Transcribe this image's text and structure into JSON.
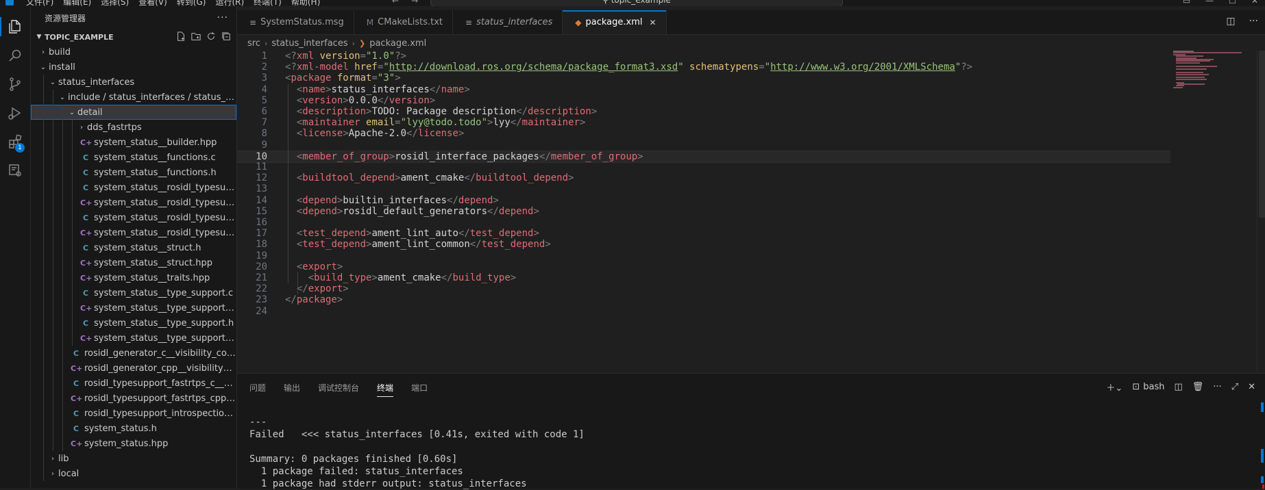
{
  "titlebar": {
    "menu": [
      "文件(F)",
      "编辑(E)",
      "选择(S)",
      "查看(V)",
      "转到(G)",
      "运行(R)",
      "终端(T)",
      "帮助(H)"
    ],
    "search_text": "topic_example"
  },
  "activity": {
    "extensions_badge": "1"
  },
  "sidebar": {
    "title": "资源管理器",
    "more": "···",
    "section": "TOPIC_EXAMPLE",
    "tree": [
      {
        "label": "build",
        "depth": 0,
        "type": "folder",
        "open": false
      },
      {
        "label": "install",
        "depth": 0,
        "type": "folder",
        "open": true
      },
      {
        "label": "status_interfaces",
        "depth": 1,
        "type": "folder",
        "open": true
      },
      {
        "label": "include / status_interfaces / status_inte…",
        "depth": 2,
        "type": "folder",
        "open": true
      },
      {
        "label": "detail",
        "depth": 3,
        "type": "folder",
        "open": true,
        "selected": true
      },
      {
        "label": "dds_fastrtps",
        "depth": 4,
        "type": "folder",
        "open": false
      },
      {
        "label": "system_status__builder.hpp",
        "depth": 4,
        "type": "cpp"
      },
      {
        "label": "system_status__functions.c",
        "depth": 4,
        "type": "c"
      },
      {
        "label": "system_status__functions.h",
        "depth": 4,
        "type": "c"
      },
      {
        "label": "system_status__rosidl_typesupport…",
        "depth": 4,
        "type": "c"
      },
      {
        "label": "system_status__rosidl_typesupport…",
        "depth": 4,
        "type": "cpp"
      },
      {
        "label": "system_status__rosidl_typesupport…",
        "depth": 4,
        "type": "c"
      },
      {
        "label": "system_status__rosidl_typesupport…",
        "depth": 4,
        "type": "cpp"
      },
      {
        "label": "system_status__struct.h",
        "depth": 4,
        "type": "c"
      },
      {
        "label": "system_status__struct.hpp",
        "depth": 4,
        "type": "cpp"
      },
      {
        "label": "system_status__traits.hpp",
        "depth": 4,
        "type": "cpp"
      },
      {
        "label": "system_status__type_support.c",
        "depth": 4,
        "type": "c"
      },
      {
        "label": "system_status__type_support.cpp",
        "depth": 4,
        "type": "cpp"
      },
      {
        "label": "system_status__type_support.h",
        "depth": 4,
        "type": "c"
      },
      {
        "label": "system_status__type_support.hpp",
        "depth": 4,
        "type": "cpp"
      },
      {
        "label": "rosidl_generator_c__visibility_control.h",
        "depth": 3,
        "type": "c"
      },
      {
        "label": "rosidl_generator_cpp__visibility_con…",
        "depth": 3,
        "type": "cpp"
      },
      {
        "label": "rosidl_typesupport_fastrtps_c__visib…",
        "depth": 3,
        "type": "c"
      },
      {
        "label": "rosidl_typesupport_fastrtps_cpp__vi…",
        "depth": 3,
        "type": "cpp"
      },
      {
        "label": "rosidl_typesupport_introspection_c_…",
        "depth": 3,
        "type": "c"
      },
      {
        "label": "system_status.h",
        "depth": 3,
        "type": "c"
      },
      {
        "label": "system_status.hpp",
        "depth": 3,
        "type": "cpp"
      },
      {
        "label": "lib",
        "depth": 1,
        "type": "folder",
        "open": false
      },
      {
        "label": "local",
        "depth": 1,
        "type": "folder",
        "open": false
      }
    ]
  },
  "tabs": [
    {
      "label": "SystemStatus.msg",
      "icon": "≡",
      "active": false,
      "italic": false
    },
    {
      "label": "CMakeLists.txt",
      "icon": "M",
      "active": false,
      "italic": false
    },
    {
      "label": "status_interfaces",
      "icon": "≡",
      "active": false,
      "italic": true
    },
    {
      "label": "package.xml",
      "icon": "◆",
      "active": true,
      "italic": false
    }
  ],
  "breadcrumb": [
    "src",
    "status_interfaces",
    "package.xml"
  ],
  "editor": {
    "current_line": 10,
    "lines": [
      {
        "n": "1",
        "tokens": [
          [
            "br",
            "<?"
          ],
          [
            "tagname",
            "xml"
          ],
          [
            "attr",
            " version"
          ],
          [
            "br",
            "="
          ],
          [
            "str",
            "\"1.0\""
          ],
          [
            "br",
            "?>"
          ]
        ]
      },
      {
        "n": "2",
        "tokens": [
          [
            "br",
            "<?"
          ],
          [
            "tagname",
            "xml-model"
          ],
          [
            "attr",
            " href"
          ],
          [
            "br",
            "="
          ],
          [
            "str",
            "\""
          ],
          [
            "url",
            "http://download.ros.org/schema/package_format3.xsd"
          ],
          [
            "str",
            "\""
          ],
          [
            "attr",
            " schematypens"
          ],
          [
            "br",
            "="
          ],
          [
            "str",
            "\""
          ],
          [
            "url",
            "http://www.w3.org/2001/XMLSchema"
          ],
          [
            "str",
            "\""
          ],
          [
            "br",
            "?>"
          ]
        ]
      },
      {
        "n": "3",
        "tokens": [
          [
            "br",
            "<"
          ],
          [
            "tagname",
            "package"
          ],
          [
            "attr",
            " format"
          ],
          [
            "br",
            "="
          ],
          [
            "str",
            "\"3\""
          ],
          [
            "br",
            ">"
          ]
        ]
      },
      {
        "n": "4",
        "tokens": [
          [
            "txt",
            "  "
          ],
          [
            "br",
            "<"
          ],
          [
            "tagname",
            "name"
          ],
          [
            "br",
            ">"
          ],
          [
            "txt",
            "status_interfaces"
          ],
          [
            "br",
            "</"
          ],
          [
            "tagname",
            "name"
          ],
          [
            "br",
            ">"
          ]
        ]
      },
      {
        "n": "5",
        "tokens": [
          [
            "txt",
            "  "
          ],
          [
            "br",
            "<"
          ],
          [
            "tagname",
            "version"
          ],
          [
            "br",
            ">"
          ],
          [
            "txt",
            "0.0.0"
          ],
          [
            "br",
            "</"
          ],
          [
            "tagname",
            "version"
          ],
          [
            "br",
            ">"
          ]
        ]
      },
      {
        "n": "6",
        "tokens": [
          [
            "txt",
            "  "
          ],
          [
            "br",
            "<"
          ],
          [
            "tagname",
            "description"
          ],
          [
            "br",
            ">"
          ],
          [
            "txt",
            "TODO: Package description"
          ],
          [
            "br",
            "</"
          ],
          [
            "tagname",
            "description"
          ],
          [
            "br",
            ">"
          ]
        ]
      },
      {
        "n": "7",
        "tokens": [
          [
            "txt",
            "  "
          ],
          [
            "br",
            "<"
          ],
          [
            "tagname",
            "maintainer"
          ],
          [
            "attr",
            " email"
          ],
          [
            "br",
            "="
          ],
          [
            "str",
            "\"lyy@todo.todo\""
          ],
          [
            "br",
            ">"
          ],
          [
            "txt",
            "lyy"
          ],
          [
            "br",
            "</"
          ],
          [
            "tagname",
            "maintainer"
          ],
          [
            "br",
            ">"
          ]
        ]
      },
      {
        "n": "8",
        "tokens": [
          [
            "txt",
            "  "
          ],
          [
            "br",
            "<"
          ],
          [
            "tagname",
            "license"
          ],
          [
            "br",
            ">"
          ],
          [
            "txt",
            "Apache-2.0"
          ],
          [
            "br",
            "</"
          ],
          [
            "tagname",
            "license"
          ],
          [
            "br",
            ">"
          ]
        ]
      },
      {
        "n": "9",
        "tokens": []
      },
      {
        "n": "10",
        "tokens": [
          [
            "txt",
            "  "
          ],
          [
            "br",
            "<"
          ],
          [
            "tagname",
            "member_of_group"
          ],
          [
            "br",
            ">"
          ],
          [
            "txt",
            "rosidl_interface_packages"
          ],
          [
            "br",
            "</"
          ],
          [
            "tagname",
            "member_of_group"
          ],
          [
            "br",
            ">"
          ]
        ]
      },
      {
        "n": "11",
        "tokens": []
      },
      {
        "n": "12",
        "tokens": [
          [
            "txt",
            "  "
          ],
          [
            "br",
            "<"
          ],
          [
            "tagname",
            "buildtool_depend"
          ],
          [
            "br",
            ">"
          ],
          [
            "txt",
            "ament_cmake"
          ],
          [
            "br",
            "</"
          ],
          [
            "tagname",
            "buildtool_depend"
          ],
          [
            "br",
            ">"
          ]
        ]
      },
      {
        "n": "13",
        "tokens": []
      },
      {
        "n": "14",
        "tokens": [
          [
            "txt",
            "  "
          ],
          [
            "br",
            "<"
          ],
          [
            "tagname",
            "depend"
          ],
          [
            "br",
            ">"
          ],
          [
            "txt",
            "builtin_interfaces"
          ],
          [
            "br",
            "</"
          ],
          [
            "tagname",
            "depend"
          ],
          [
            "br",
            ">"
          ]
        ]
      },
      {
        "n": "15",
        "tokens": [
          [
            "txt",
            "  "
          ],
          [
            "br",
            "<"
          ],
          [
            "tagname",
            "depend"
          ],
          [
            "br",
            ">"
          ],
          [
            "txt",
            "rosidl_default_generators"
          ],
          [
            "br",
            "</"
          ],
          [
            "tagname",
            "depend"
          ],
          [
            "br",
            ">"
          ]
        ]
      },
      {
        "n": "16",
        "tokens": []
      },
      {
        "n": "17",
        "tokens": [
          [
            "txt",
            "  "
          ],
          [
            "br",
            "<"
          ],
          [
            "tagname",
            "test_depend"
          ],
          [
            "br",
            ">"
          ],
          [
            "txt",
            "ament_lint_auto"
          ],
          [
            "br",
            "</"
          ],
          [
            "tagname",
            "test_depend"
          ],
          [
            "br",
            ">"
          ]
        ]
      },
      {
        "n": "18",
        "tokens": [
          [
            "txt",
            "  "
          ],
          [
            "br",
            "<"
          ],
          [
            "tagname",
            "test_depend"
          ],
          [
            "br",
            ">"
          ],
          [
            "txt",
            "ament_lint_common"
          ],
          [
            "br",
            "</"
          ],
          [
            "tagname",
            "test_depend"
          ],
          [
            "br",
            ">"
          ]
        ]
      },
      {
        "n": "19",
        "tokens": []
      },
      {
        "n": "20",
        "tokens": [
          [
            "txt",
            "  "
          ],
          [
            "br",
            "<"
          ],
          [
            "tagname",
            "export"
          ],
          [
            "br",
            ">"
          ]
        ]
      },
      {
        "n": "21",
        "tokens": [
          [
            "txt",
            "    "
          ],
          [
            "br",
            "<"
          ],
          [
            "tagname",
            "build_type"
          ],
          [
            "br",
            ">"
          ],
          [
            "txt",
            "ament_cmake"
          ],
          [
            "br",
            "</"
          ],
          [
            "tagname",
            "build_type"
          ],
          [
            "br",
            ">"
          ]
        ]
      },
      {
        "n": "22",
        "tokens": [
          [
            "txt",
            "  "
          ],
          [
            "br",
            "</"
          ],
          [
            "tagname",
            "export"
          ],
          [
            "br",
            ">"
          ]
        ]
      },
      {
        "n": "23",
        "tokens": [
          [
            "br",
            "</"
          ],
          [
            "tagname",
            "package"
          ],
          [
            "br",
            ">"
          ]
        ]
      },
      {
        "n": "24",
        "tokens": []
      }
    ]
  },
  "panel": {
    "tabs": [
      {
        "label": "问题",
        "active": false
      },
      {
        "label": "输出",
        "active": false
      },
      {
        "label": "调试控制台",
        "active": false
      },
      {
        "label": "终端",
        "active": true
      },
      {
        "label": "端口",
        "active": false
      }
    ],
    "shell": "bash",
    "terminal_lines": [
      "---",
      "Failed   <<< status_interfaces [0.41s, exited with code 1]",
      "",
      "Summary: 0 packages finished [0.60s]",
      "  1 package failed: status_interfaces",
      "  1 package had stderr output: status_interfaces"
    ]
  },
  "colors": {
    "accent": "#0078d4",
    "tag": "#e06c75",
    "attr": "#e5c07b",
    "string": "#98c379"
  }
}
